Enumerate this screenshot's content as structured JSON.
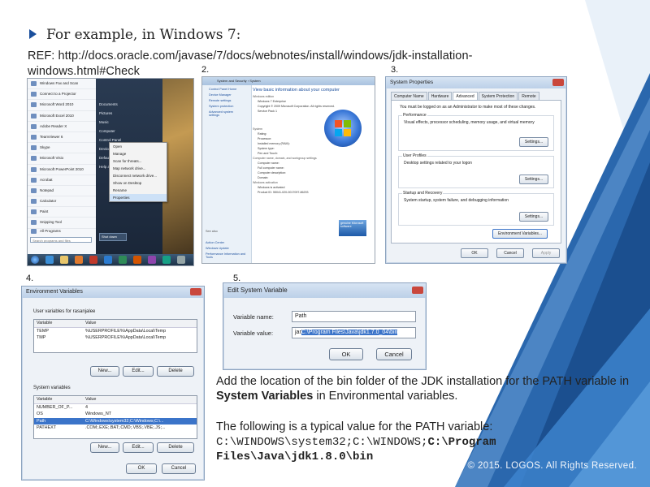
{
  "heading": "For example, in Windows 7:",
  "ref": "REF: http://docs.oracle.com/javase/7/docs/webnotes/install/windows/jdk-installation-windows.html#Check",
  "labels": {
    "s2": "2.",
    "s3": "3.",
    "s4": "4.",
    "s5": "5."
  },
  "start_menu": {
    "left_items": [
      "Windows Fax and Scan",
      "Connect to a Projector",
      "Microsoft Word 2010",
      "Microsoft Excel 2010",
      "Adobe Reader X",
      "TeamViewer 6",
      "Skype",
      "Microsoft Visio",
      "Microsoft PowerPoint 2010",
      "Acrobat",
      "Notepad",
      "Calculator",
      "Paint",
      "Snipping Tool"
    ],
    "all_programs": "All Programs",
    "search_placeholder": "Search programs and files",
    "right_items": [
      "Documents",
      "Pictures",
      "Music",
      "Computer",
      "Control Panel",
      "Devices and Printers",
      "Default Programs",
      "Help and Support"
    ],
    "context_menu": [
      "Open",
      "Manage",
      "Scan for threats...",
      "Map network drive...",
      "Disconnect network drive...",
      "Show on Desktop",
      "Rename",
      "Properties"
    ],
    "shutdown": "Shut down"
  },
  "system_window": {
    "breadcrumb": "System and Security › System",
    "side_links": [
      "Control Panel Home",
      "Device Manager",
      "Remote settings",
      "System protection",
      "Advanced system settings"
    ],
    "see_also": "See also",
    "see_also_links": [
      "Action Center",
      "Windows Update",
      "Performance Information and Tools"
    ],
    "main_title": "View basic information about your computer",
    "edition_hdr": "Windows edition",
    "edition_lines": [
      "Windows 7 Enterprise",
      "Copyright © 2009 Microsoft Corporation. All rights reserved.",
      "Service Pack 1"
    ],
    "system_hdr": "System",
    "system_lines": [
      "Rating:",
      "Processor:",
      "Installed memory (RAM):",
      "System type:",
      "Pen and Touch:"
    ],
    "name_hdr": "Computer name, domain, and workgroup settings",
    "name_lines": [
      "Computer name:",
      "Full computer name:",
      "Computer description:",
      "Domain:"
    ],
    "activation_hdr": "Windows activation",
    "activation_lines": [
      "Windows is activated",
      "Product ID: 55041-020-0017097-86293"
    ],
    "genuine_badge": "genuine Microsoft software"
  },
  "system_properties": {
    "title": "System Properties",
    "tabs": [
      "Computer Name",
      "Hardware",
      "Advanced",
      "System Protection",
      "Remote"
    ],
    "active_tab": "Advanced",
    "admin_note": "You must be logged on as an Administrator to make most of these changes.",
    "groups": [
      {
        "label": "Performance",
        "text": "Visual effects, processor scheduling, memory usage, and virtual memory",
        "button": "Settings..."
      },
      {
        "label": "User Profiles",
        "text": "Desktop settings related to your logon",
        "button": "Settings..."
      },
      {
        "label": "Startup and Recovery",
        "text": "System startup, system failure, and debugging information",
        "button": "Settings..."
      }
    ],
    "env_button": "Environment Variables...",
    "ok": "OK",
    "cancel": "Cancel",
    "apply": "Apply"
  },
  "env_vars": {
    "title": "Environment Variables",
    "user_vars_label": "User variables for rasanjalee",
    "col_variable": "Variable",
    "col_value": "Value",
    "user_rows": [
      {
        "var": "TEMP",
        "val": "%USERPROFILE%\\AppData\\Local\\Temp"
      },
      {
        "var": "TMP",
        "val": "%USERPROFILE%\\AppData\\Local\\Temp"
      }
    ],
    "sys_vars_label": "System variables",
    "sys_rows": [
      {
        "var": "NUMBER_OF_P...",
        "val": "4"
      },
      {
        "var": "OS",
        "val": "Windows_NT"
      },
      {
        "var": "Path",
        "val": "C:\\Windows\\system32;C:\\Windows;C:\\..."
      },
      {
        "var": "PATHEXT",
        "val": ".COM;.EXE;.BAT;.CMD;.VBS;.VBE;.JS;..."
      }
    ],
    "selected_sys_row": 2,
    "new": "New...",
    "edit": "Edit...",
    "delete": "Delete",
    "ok": "OK",
    "cancel": "Cancel"
  },
  "edit_var": {
    "title": "Edit System Variable",
    "name_label": "Variable name:",
    "name_value": "Path",
    "value_label": "Variable value:",
    "value_prefix": "jar",
    "value_selected": "C:\\Program Files\\Java\\jdk1.7.0_04\\bin",
    "ok": "OK",
    "cancel": "Cancel"
  },
  "body": {
    "p1_a": "Add the location of the bin folder of the JDK installation for the PATH variable in ",
    "p1_bold": "System Variables",
    "p1_b": " in Environmental variables.",
    "p2": "The following is a typical value for the PATH variable:",
    "p3_plain": "C:\\WINDOWS\\system32;C:\\WINDOWS;",
    "p3_bold_a": "C:\\Program",
    "p3_bold_b": "Files\\Java\\jdk1.8.0\\bin"
  },
  "footer": "© 2015. LOGOS. All Rights Reserved.",
  "colors": {
    "accent": "#1b4f9c",
    "deco_dark": "#1f4f8c",
    "deco_light": "#3d78b8"
  }
}
